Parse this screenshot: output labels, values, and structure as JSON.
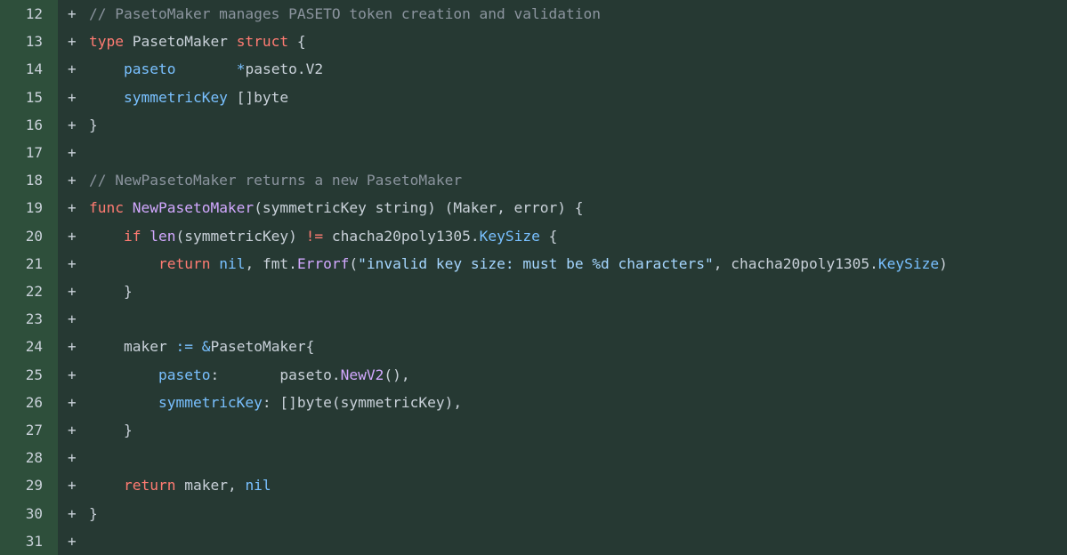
{
  "lines": [
    {
      "num": "12",
      "marker": "+",
      "tokens": [
        {
          "t": "// PasetoMaker manages PASETO token creation and validation",
          "c": "c"
        }
      ]
    },
    {
      "num": "13",
      "marker": "+",
      "tokens": [
        {
          "t": "type",
          "c": "k"
        },
        {
          "t": " PasetoMaker ",
          "c": "p"
        },
        {
          "t": "struct",
          "c": "k"
        },
        {
          "t": " {",
          "c": "p"
        }
      ]
    },
    {
      "num": "14",
      "marker": "+",
      "tokens": [
        {
          "t": "    ",
          "c": "p"
        },
        {
          "t": "paseto",
          "c": "v"
        },
        {
          "t": "       ",
          "c": "p"
        },
        {
          "t": "*",
          "c": "v"
        },
        {
          "t": "paseto.V2",
          "c": "p"
        }
      ]
    },
    {
      "num": "15",
      "marker": "+",
      "tokens": [
        {
          "t": "    ",
          "c": "p"
        },
        {
          "t": "symmetricKey",
          "c": "v"
        },
        {
          "t": " []byte",
          "c": "p"
        }
      ]
    },
    {
      "num": "16",
      "marker": "+",
      "tokens": [
        {
          "t": "}",
          "c": "p"
        }
      ]
    },
    {
      "num": "17",
      "marker": "+",
      "tokens": []
    },
    {
      "num": "18",
      "marker": "+",
      "tokens": [
        {
          "t": "// NewPasetoMaker returns a new PasetoMaker",
          "c": "c"
        }
      ]
    },
    {
      "num": "19",
      "marker": "+",
      "tokens": [
        {
          "t": "func",
          "c": "k"
        },
        {
          "t": " ",
          "c": "p"
        },
        {
          "t": "NewPasetoMaker",
          "c": "f"
        },
        {
          "t": "(symmetricKey string) (Maker, error) {",
          "c": "p"
        }
      ]
    },
    {
      "num": "20",
      "marker": "+",
      "tokens": [
        {
          "t": "    ",
          "c": "p"
        },
        {
          "t": "if",
          "c": "k"
        },
        {
          "t": " ",
          "c": "p"
        },
        {
          "t": "len",
          "c": "f"
        },
        {
          "t": "(symmetricKey) ",
          "c": "p"
        },
        {
          "t": "!=",
          "c": "k"
        },
        {
          "t": " chacha20poly1305.",
          "c": "p"
        },
        {
          "t": "KeySize",
          "c": "v"
        },
        {
          "t": " {",
          "c": "p"
        }
      ]
    },
    {
      "num": "21",
      "marker": "+",
      "tokens": [
        {
          "t": "        ",
          "c": "p"
        },
        {
          "t": "return",
          "c": "k"
        },
        {
          "t": " ",
          "c": "p"
        },
        {
          "t": "nil",
          "c": "v"
        },
        {
          "t": ", fmt.",
          "c": "p"
        },
        {
          "t": "Errorf",
          "c": "f"
        },
        {
          "t": "(",
          "c": "p"
        },
        {
          "t": "\"invalid key size: must be %d characters\"",
          "c": "s"
        },
        {
          "t": ", chacha20poly1305.",
          "c": "p"
        },
        {
          "t": "KeySize",
          "c": "v"
        },
        {
          "t": ")",
          "c": "p"
        }
      ]
    },
    {
      "num": "22",
      "marker": "+",
      "tokens": [
        {
          "t": "    }",
          "c": "p"
        }
      ]
    },
    {
      "num": "23",
      "marker": "+",
      "tokens": []
    },
    {
      "num": "24",
      "marker": "+",
      "tokens": [
        {
          "t": "    maker ",
          "c": "p"
        },
        {
          "t": ":=",
          "c": "v"
        },
        {
          "t": " ",
          "c": "p"
        },
        {
          "t": "&",
          "c": "v"
        },
        {
          "t": "PasetoMaker{",
          "c": "p"
        }
      ]
    },
    {
      "num": "25",
      "marker": "+",
      "tokens": [
        {
          "t": "        ",
          "c": "p"
        },
        {
          "t": "paseto",
          "c": "v"
        },
        {
          "t": ":       paseto.",
          "c": "p"
        },
        {
          "t": "NewV2",
          "c": "f"
        },
        {
          "t": "(),",
          "c": "p"
        }
      ]
    },
    {
      "num": "26",
      "marker": "+",
      "tokens": [
        {
          "t": "        ",
          "c": "p"
        },
        {
          "t": "symmetricKey",
          "c": "v"
        },
        {
          "t": ": []byte(symmetricKey),",
          "c": "p"
        }
      ]
    },
    {
      "num": "27",
      "marker": "+",
      "tokens": [
        {
          "t": "    }",
          "c": "p"
        }
      ]
    },
    {
      "num": "28",
      "marker": "+",
      "tokens": []
    },
    {
      "num": "29",
      "marker": "+",
      "tokens": [
        {
          "t": "    ",
          "c": "p"
        },
        {
          "t": "return",
          "c": "k"
        },
        {
          "t": " maker, ",
          "c": "p"
        },
        {
          "t": "nil",
          "c": "v"
        }
      ]
    },
    {
      "num": "30",
      "marker": "+",
      "tokens": [
        {
          "t": "}",
          "c": "p"
        }
      ]
    },
    {
      "num": "31",
      "marker": "+",
      "tokens": []
    }
  ]
}
